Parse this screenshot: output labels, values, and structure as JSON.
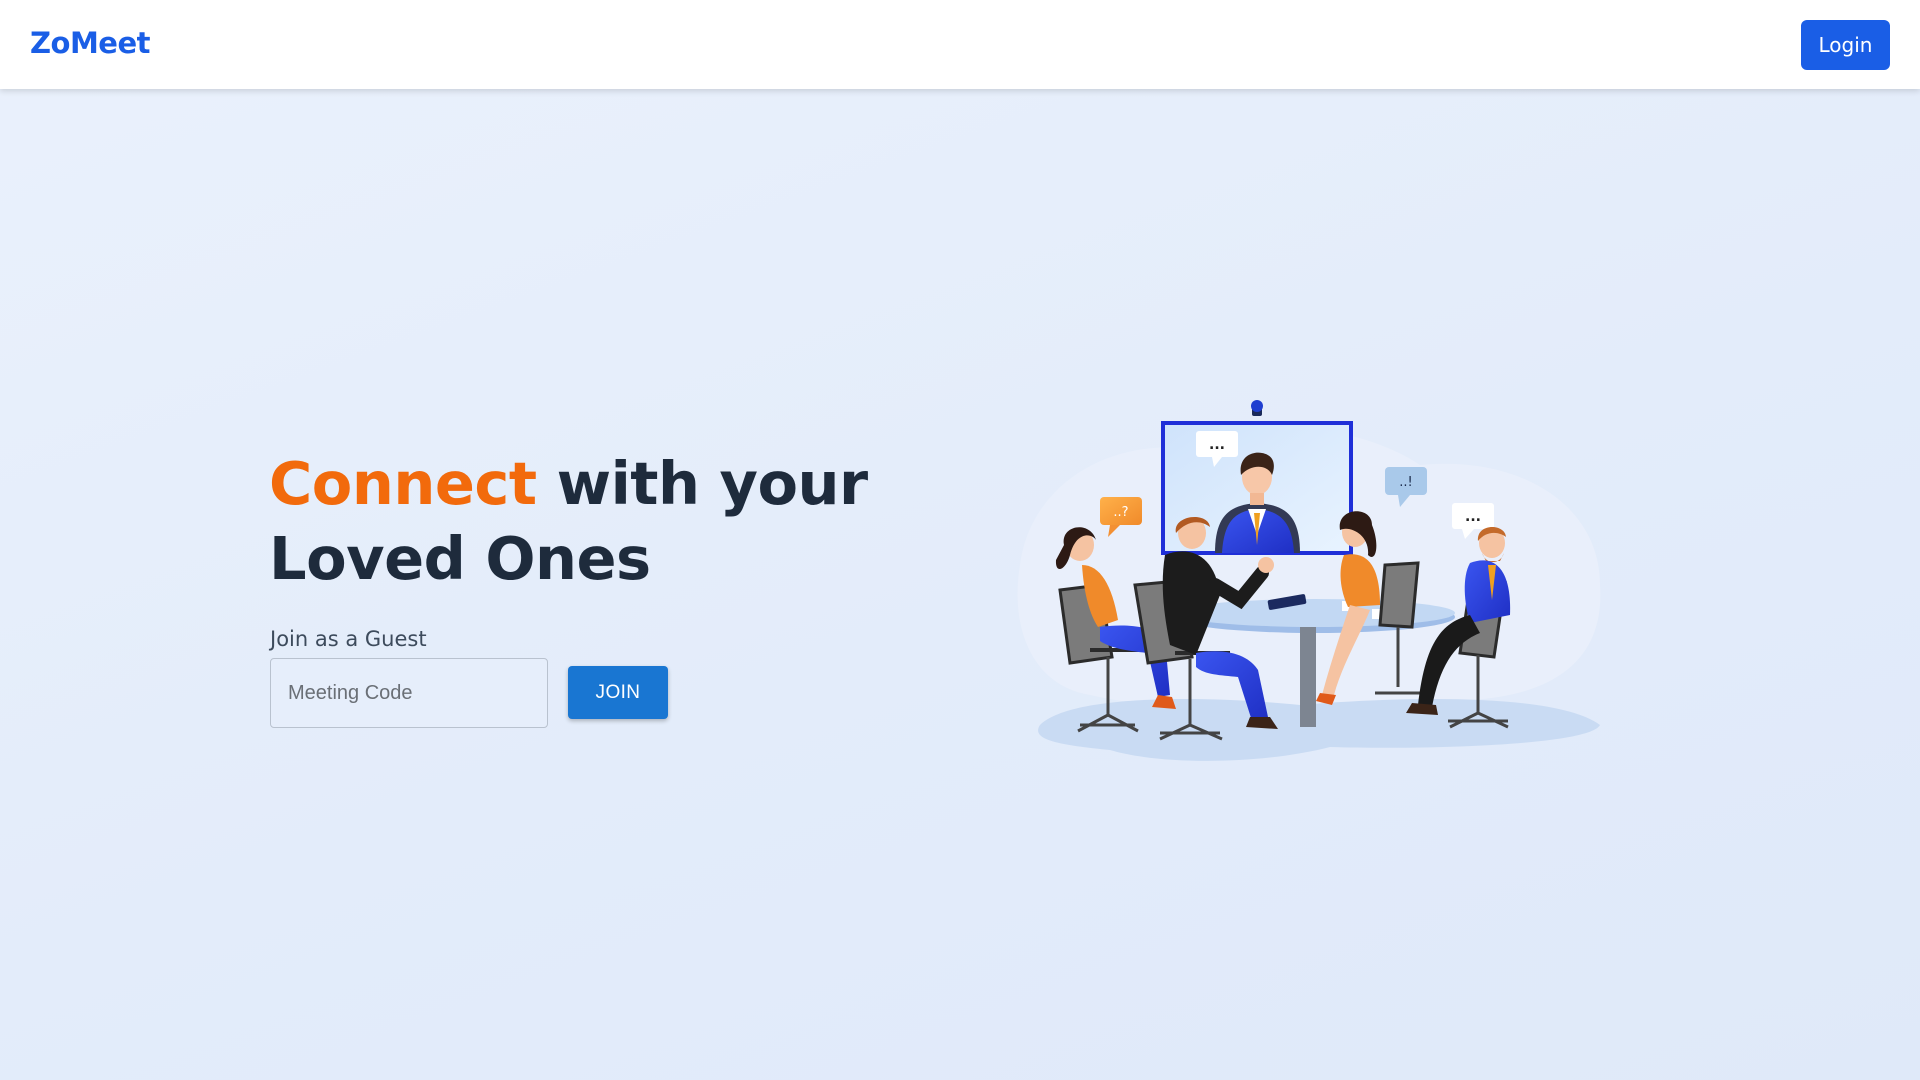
{
  "app": {
    "brand": "ZoMeet"
  },
  "header": {
    "login_label": "Login"
  },
  "hero": {
    "title_accent": "Connect",
    "title_rest": " with your",
    "title_line2": "Loved Ones"
  },
  "guest": {
    "label": "Join as a Guest",
    "code_placeholder": "Meeting Code",
    "code_value": "",
    "join_label": "JOIN"
  },
  "illustration": {
    "bubble_question": "..?",
    "bubble_screen": "...",
    "bubble_exclaim": "..!",
    "bubble_right": "..."
  },
  "colors": {
    "brand_blue": "#1a5ee6",
    "accent_orange": "#f26a0c",
    "join_blue": "#1976d2",
    "heading_dark": "#1e2b3c"
  },
  "icons": [
    "meeting-illustration",
    "webcam-icon"
  ]
}
